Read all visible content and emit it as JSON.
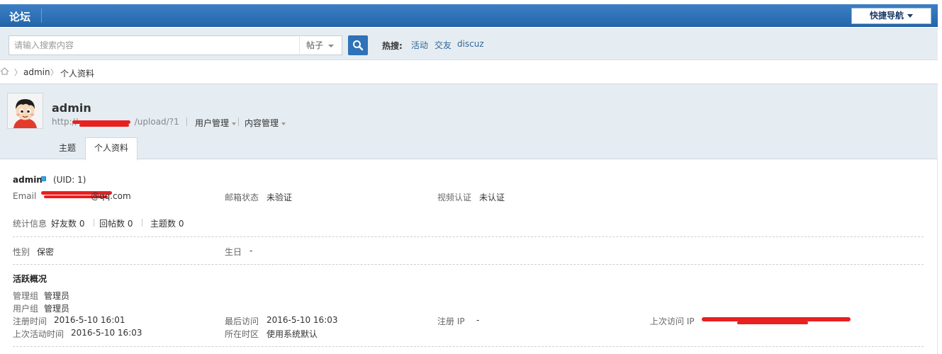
{
  "topbar": {
    "brand": "论坛",
    "quicknav": "快捷导航"
  },
  "search": {
    "placeholder": "请输入搜索内容",
    "type": "帖子",
    "hot_label": "热搜:",
    "hot_links": [
      "活动",
      "交友",
      "discuz"
    ]
  },
  "breadcrumb": {
    "items": [
      "admin",
      "个人资料"
    ]
  },
  "profile": {
    "username": "admin",
    "url_start": "http://",
    "url_end": "/upload/?1",
    "menus": [
      "用户管理",
      "内容管理"
    ],
    "tabs": [
      "主题",
      "个人资料"
    ]
  },
  "info": {
    "name": "admin",
    "uid": "(UID: 1)",
    "email_label": "Email",
    "email_end": "@qq.com",
    "email_status_label": "邮箱状态",
    "email_status": "未验证",
    "video_label": "视频认证",
    "video_status": "未认证",
    "stats_label": "统计信息",
    "friends_label": "好友数",
    "friends": "0",
    "replies_label": "回帖数",
    "replies": "0",
    "threads_label": "主题数",
    "threads": "0",
    "gender_label": "性别",
    "gender": "保密",
    "birthday_label": "生日",
    "birthday": "-"
  },
  "activity": {
    "title": "活跃概况",
    "admin_group_label": "管理组",
    "admin_group": "管理员",
    "user_group_label": "用户组",
    "user_group": "管理员",
    "reg_time_label": "注册时间",
    "reg_time": "2016-5-10 16:01",
    "last_visit_label": "最后访问",
    "last_visit": "2016-5-10 16:03",
    "reg_ip_label": "注册 IP",
    "reg_ip": "-",
    "last_ip_label": "上次访问 IP",
    "last_active_label": "上次活动时间",
    "last_active": "2016-5-10 16:03",
    "timezone_label": "所在时区",
    "timezone": "使用系统默认"
  }
}
